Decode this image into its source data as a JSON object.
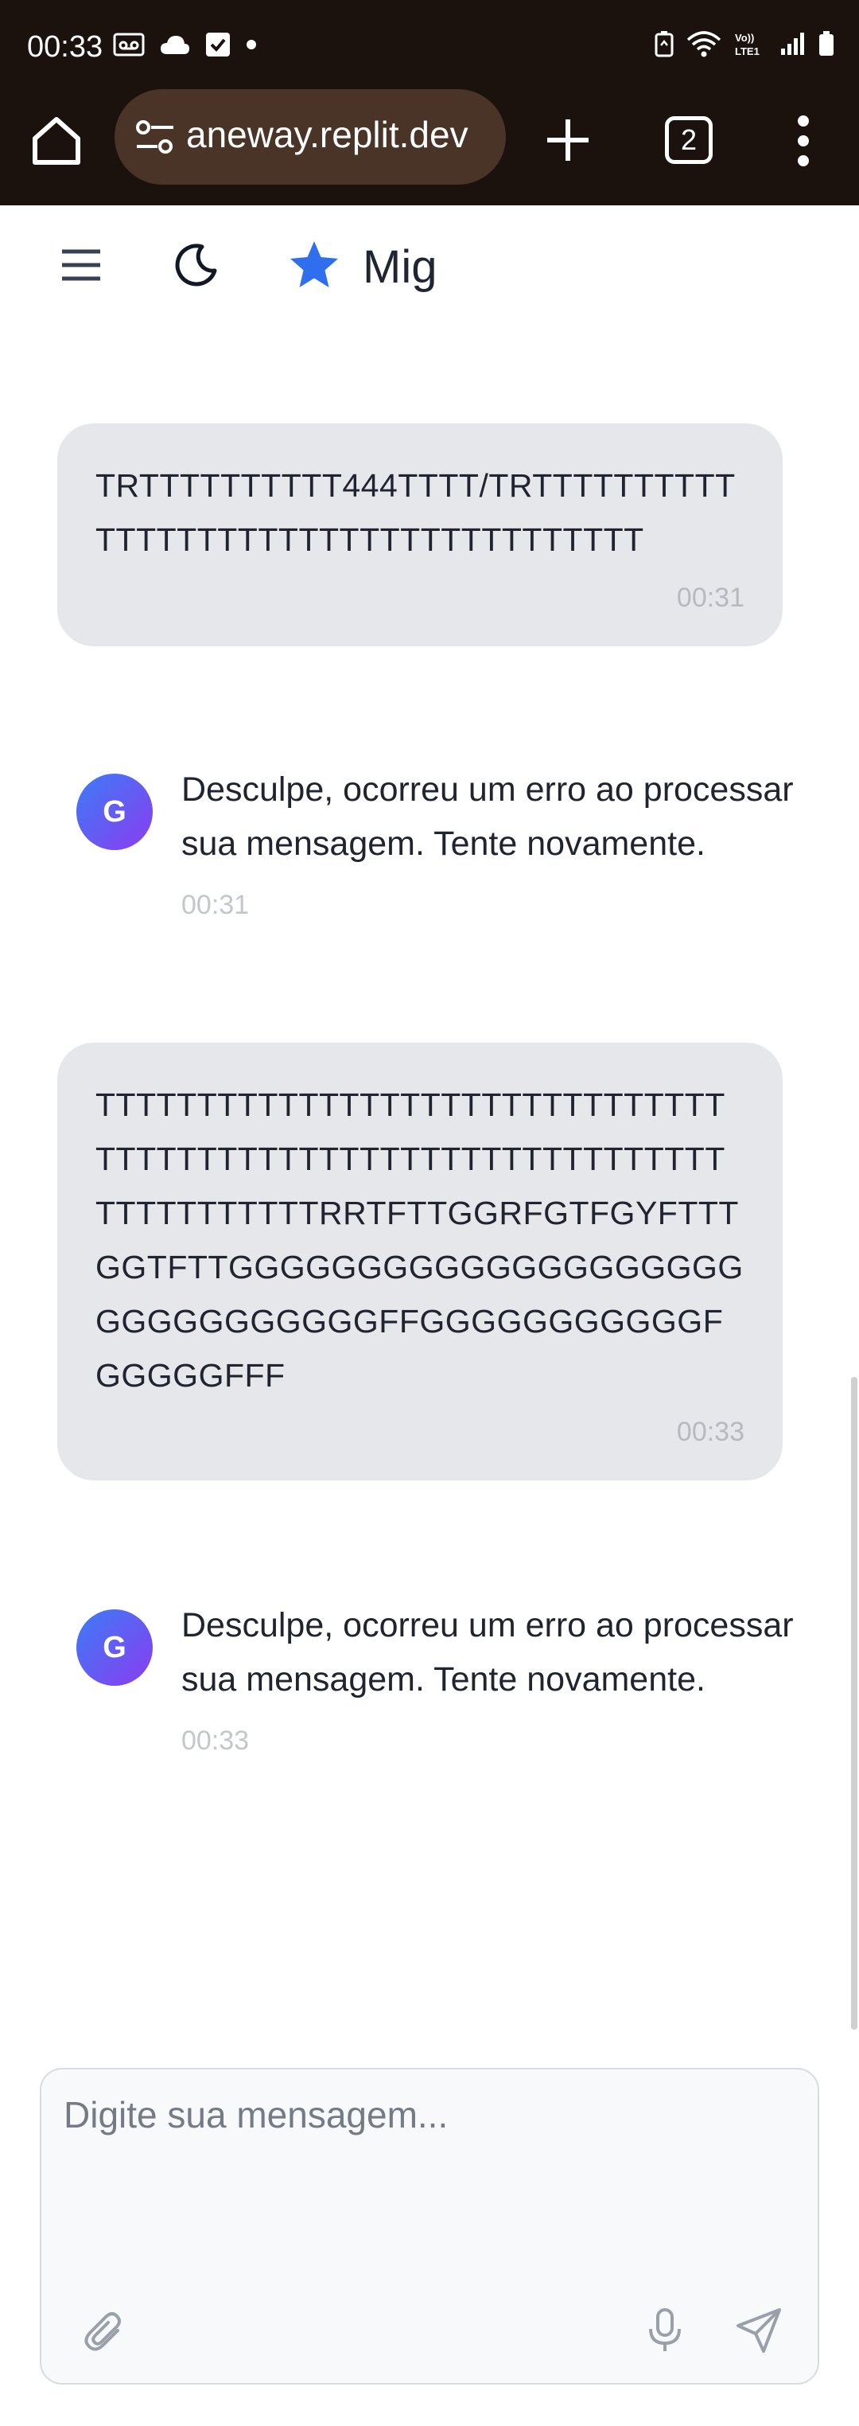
{
  "status": {
    "time": "00:33"
  },
  "browser": {
    "url": "aneway.replit.dev",
    "tab_count": "2"
  },
  "app": {
    "title": "Mig"
  },
  "messages": [
    {
      "role": "user",
      "text": "TRTTTTTTTTTT444TTTT/TRTTTTTTTTTTTTTTTTTTTTTTTTTTTTTTTTTTTTT",
      "time": "00:31"
    },
    {
      "role": "assistant",
      "avatar": "G",
      "text": "Desculpe, ocorreu um erro ao proces­sar sua mensagem. Tente novamente.",
      "time": "00:31"
    },
    {
      "role": "user",
      "text": "TTTTTTTTTTTTTTTTTTTTTTTTTTTTTTTTTTTTTTTTTTTTTTTTTTTTTTTTTTTTTTTTTTTTTTTTTRRTFTTGGRFGTFGYFTTTGGTFTTGGGGGGGGGGGGGGGGGGGGGGGGGGGGGGGFFGGGGGGGGGGGFGGGGGFFF",
      "time": "00:33"
    },
    {
      "role": "assistant",
      "avatar": "G",
      "text": "Desculpe, ocorreu um erro ao proces­sar sua mensagem. Tente novamente.",
      "time": "00:33"
    }
  ],
  "composer": {
    "placeholder": "Digite sua mensagem..."
  },
  "colors": {
    "status_bar": "#1b120e",
    "url_pill": "#4a3428",
    "accent_star": "#2f6fed",
    "user_bubble": "#e6e7ea",
    "avatar_gradient_start": "#3b7cf6",
    "avatar_gradient_end": "#8b3cf0"
  }
}
